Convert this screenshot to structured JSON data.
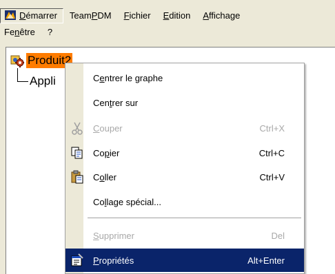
{
  "colors": {
    "menubar_bg": "#ece9d8",
    "selection_orange": "#ff7c00",
    "highlight_navy": "#0a246a",
    "disabled_text": "#a8a8a8"
  },
  "menubar": {
    "items": [
      {
        "label_pre": "",
        "label_ul": "D",
        "label_post": "émarrer",
        "active": true,
        "icon": "catia-logo-icon"
      },
      {
        "label_pre": "Team",
        "label_ul": "P",
        "label_post": "DM"
      },
      {
        "label_pre": "",
        "label_ul": "F",
        "label_post": "ichier"
      },
      {
        "label_pre": "",
        "label_ul": "E",
        "label_post": "dition"
      },
      {
        "label_pre": "",
        "label_ul": "A",
        "label_post": "ffichage"
      }
    ],
    "row2": [
      {
        "label_pre": "Fe",
        "label_ul": "n",
        "label_post": "être"
      },
      {
        "label_pre": "?",
        "label_ul": "",
        "label_post": ""
      }
    ]
  },
  "tree": {
    "root_label": "Produit2",
    "root_icon": "product-gear-icon",
    "child_label": "Appli"
  },
  "context_menu": {
    "items": [
      {
        "pre": "C",
        "ul": "e",
        "post": "ntrer le graphe",
        "shortcut": "",
        "icon": "",
        "disabled": false
      },
      {
        "pre": "Cen",
        "ul": "t",
        "post": "rer sur",
        "shortcut": "",
        "icon": "",
        "disabled": false
      },
      {
        "pre": "",
        "ul": "C",
        "post": "ouper",
        "shortcut": "Ctrl+X",
        "icon": "scissors-icon",
        "disabled": true
      },
      {
        "pre": "Co",
        "ul": "p",
        "post": "ier",
        "shortcut": "Ctrl+C",
        "icon": "copy-icon",
        "disabled": false
      },
      {
        "pre": "C",
        "ul": "o",
        "post": "ller",
        "shortcut": "Ctrl+V",
        "icon": "paste-icon",
        "disabled": false
      },
      {
        "pre": "Co",
        "ul": "l",
        "post": "lage spécial...",
        "shortcut": "",
        "icon": "",
        "disabled": false
      },
      {
        "pre": "",
        "ul": "S",
        "post": "upprimer",
        "shortcut": "Del",
        "icon": "",
        "disabled": true
      },
      {
        "pre": "",
        "ul": "P",
        "post": "ropriétés",
        "shortcut": "Alt+Enter",
        "icon": "properties-icon",
        "disabled": false,
        "highlighted": true
      }
    ]
  }
}
